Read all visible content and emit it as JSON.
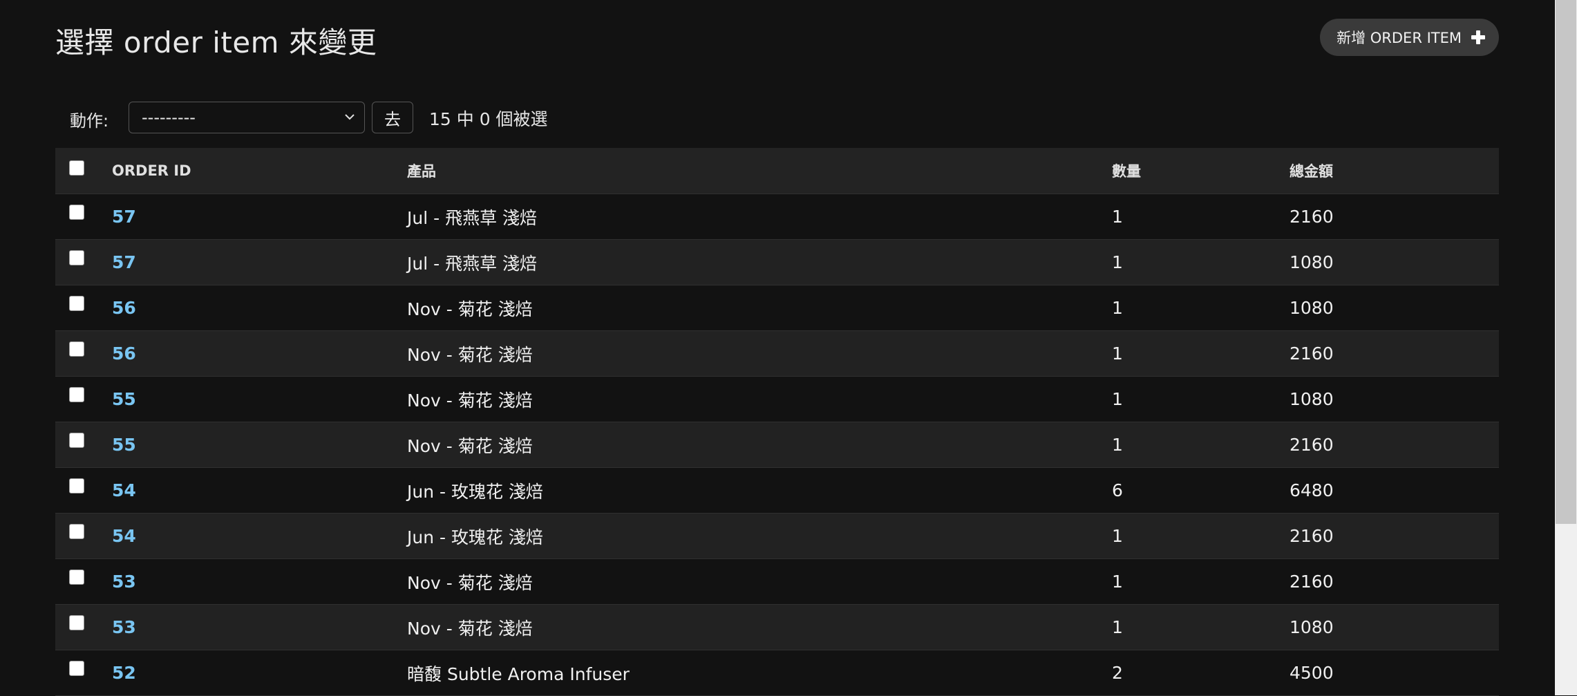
{
  "page": {
    "title": "選擇 order item 來變更",
    "add_button_label": "新增 ORDER ITEM"
  },
  "actions": {
    "label": "動作:",
    "selected_option": "---------",
    "go_label": "去",
    "selection_count": "15 中 0 個被選"
  },
  "table": {
    "headers": {
      "order_id": "ORDER ID",
      "product": "產品",
      "quantity": "數量",
      "total": "總金額"
    },
    "rows": [
      {
        "order_id": "57",
        "product": "Jul - 飛燕草 淺焙",
        "quantity": "1",
        "total": "2160"
      },
      {
        "order_id": "57",
        "product": "Jul - 飛燕草 淺焙",
        "quantity": "1",
        "total": "1080"
      },
      {
        "order_id": "56",
        "product": "Nov - 菊花 淺焙",
        "quantity": "1",
        "total": "1080"
      },
      {
        "order_id": "56",
        "product": "Nov - 菊花 淺焙",
        "quantity": "1",
        "total": "2160"
      },
      {
        "order_id": "55",
        "product": "Nov - 菊花 淺焙",
        "quantity": "1",
        "total": "1080"
      },
      {
        "order_id": "55",
        "product": "Nov - 菊花 淺焙",
        "quantity": "1",
        "total": "2160"
      },
      {
        "order_id": "54",
        "product": "Jun - 玫瑰花 淺焙",
        "quantity": "6",
        "total": "6480"
      },
      {
        "order_id": "54",
        "product": "Jun - 玫瑰花 淺焙",
        "quantity": "1",
        "total": "2160"
      },
      {
        "order_id": "53",
        "product": "Nov - 菊花 淺焙",
        "quantity": "1",
        "total": "2160"
      },
      {
        "order_id": "53",
        "product": "Nov - 菊花 淺焙",
        "quantity": "1",
        "total": "1080"
      },
      {
        "order_id": "52",
        "product": "暗馥 Subtle Aroma Infuser",
        "quantity": "2",
        "total": "4500"
      }
    ]
  },
  "colors": {
    "background": "#121212",
    "row_alt": "#222222",
    "header_row": "#232323",
    "link": "#79c5f2",
    "button": "#3a3a3a"
  }
}
